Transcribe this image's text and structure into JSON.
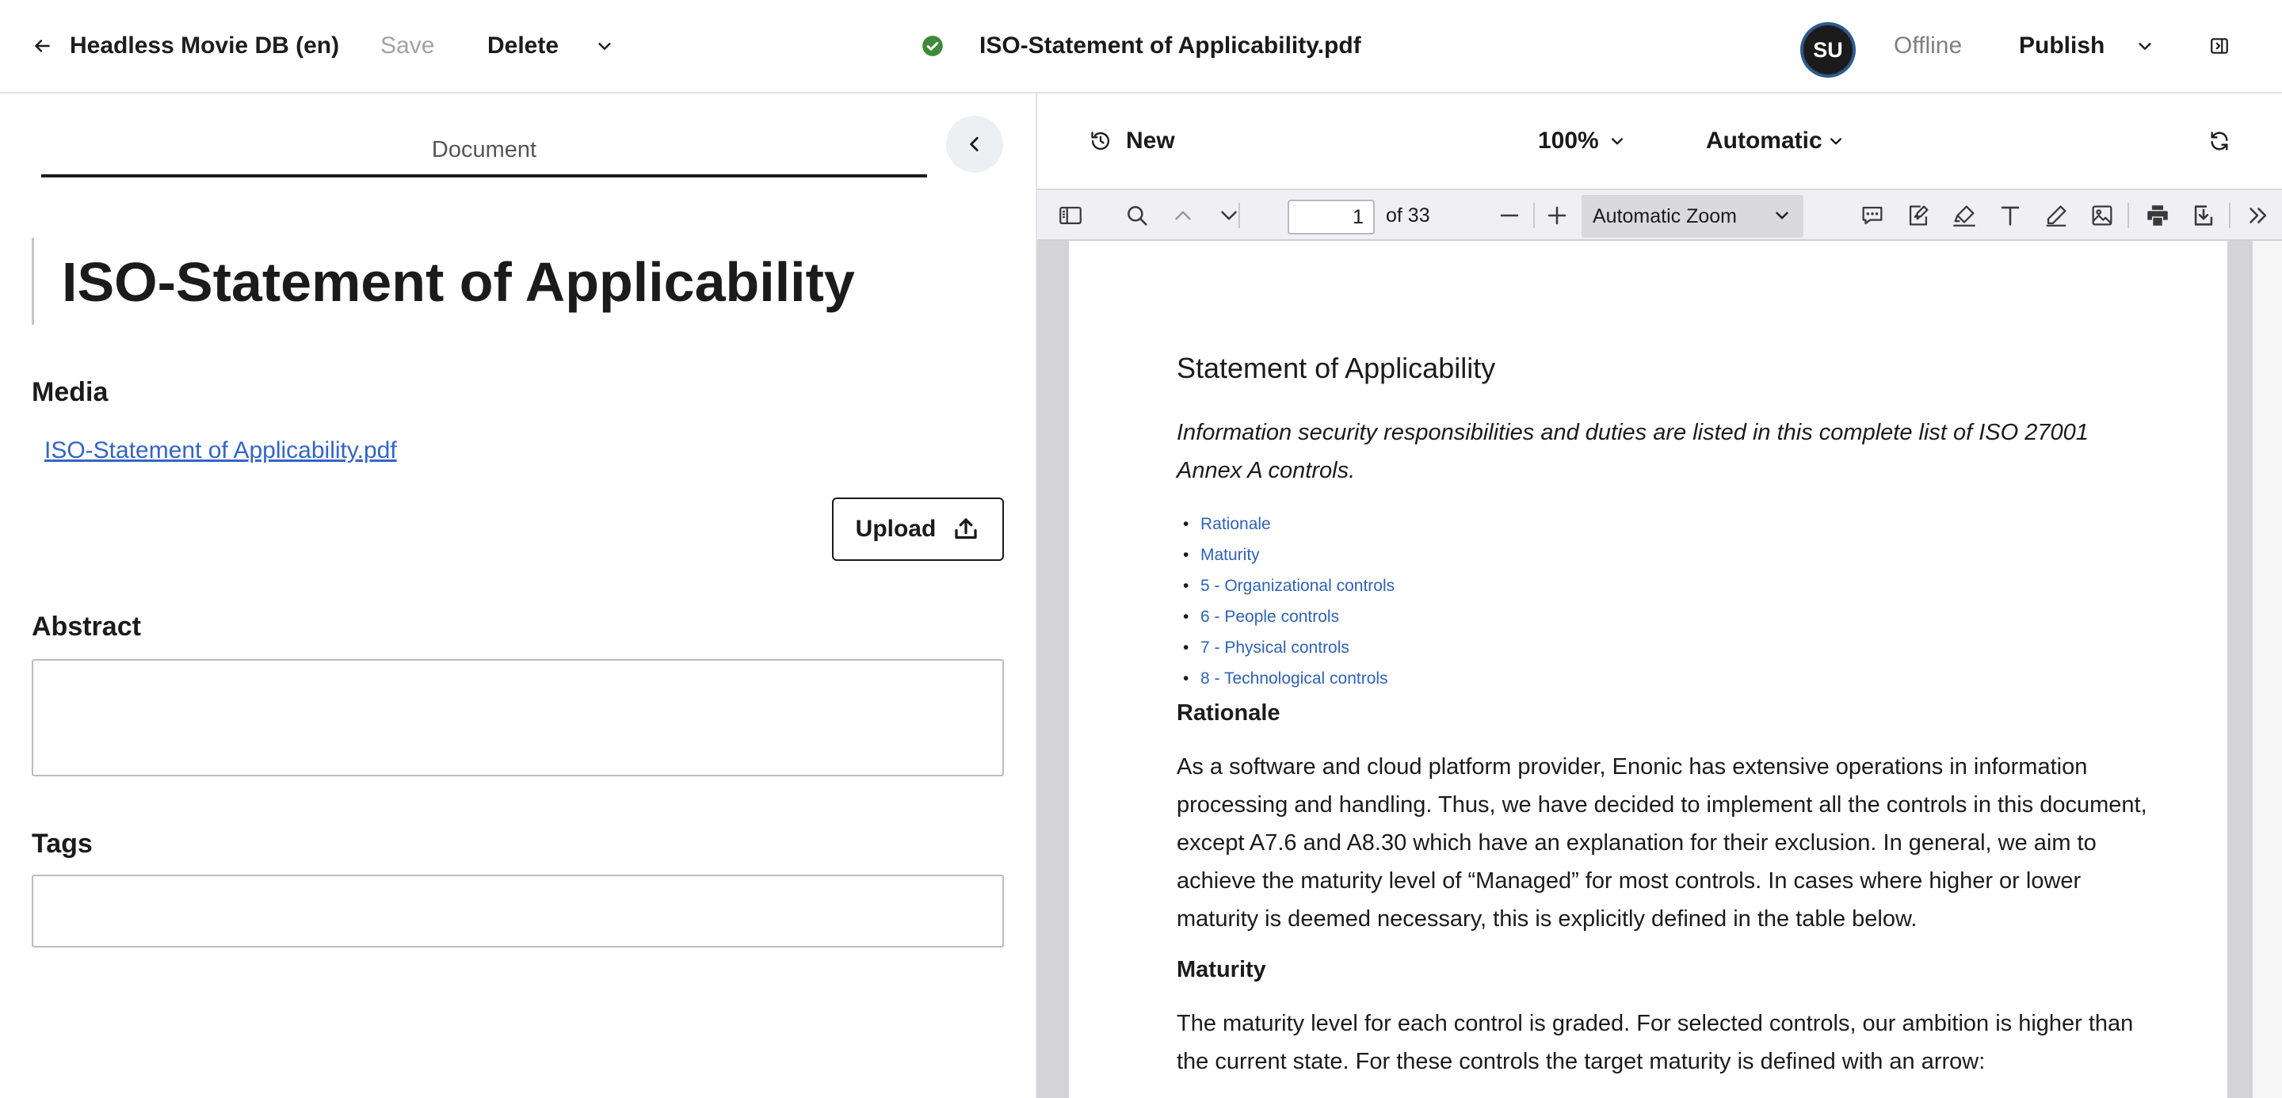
{
  "header": {
    "app_title": "Headless Movie DB (en)",
    "save_label": "Save",
    "delete_label": "Delete",
    "document_name": "ISO-Statement of Applicability.pdf",
    "avatar_initials": "SU",
    "status_text": "Offline",
    "publish_label": "Publish",
    "status_color": "#3e8a3a",
    "icons": [
      "back-arrow-icon",
      "chevron-down-icon",
      "check-circle-icon",
      "panel-toggle-icon"
    ]
  },
  "editor": {
    "tab_label": "Document",
    "page_title": "ISO-Statement of Applicability",
    "media_label": "Media",
    "media_file": "ISO-Statement of Applicability.pdf",
    "upload_label": "Upload",
    "abstract_label": "Abstract",
    "abstract_value": "",
    "tags_label": "Tags",
    "tags_value": ""
  },
  "preview": {
    "mode_label": "New",
    "zoom_value": "100%",
    "device_value": "Automatic",
    "viewer": {
      "current_page": "1",
      "page_count_text": "of 33",
      "zoom_option": "Automatic Zoom"
    },
    "pdf": {
      "heading": "Statement of Applicability",
      "intro": "Information security responsibilities and duties are listed in this complete list of ISO 27001 Annex A controls.",
      "toc": [
        "Rationale",
        "Maturity",
        "5 - Organizational controls",
        "6 - People controls",
        "7 - Physical controls",
        "8 - Technological controls"
      ],
      "rationale_heading": "Rationale",
      "rationale_text": "As a software and cloud platform provider, Enonic has extensive operations in information processing and handling. Thus, we have decided to implement all the controls in this document, except A7.6 and A8.30 which have an explanation for their exclusion.  In general, we aim to achieve the maturity level of “Managed” for most controls. In cases where higher or lower maturity is deemed necessary, this is explicitly defined in the table below.",
      "maturity_heading": "Maturity",
      "maturity_text": "The maturity level for each control is graded. For selected controls, our ambition is higher than the current state. For these controls the target maturity is defined with an arrow:"
    }
  },
  "colors": {
    "link": "#3365c6",
    "pdf_link": "#2f62b8",
    "avatar_bg": "#1b1b1b",
    "avatar_ring": "#2e5a8c"
  }
}
